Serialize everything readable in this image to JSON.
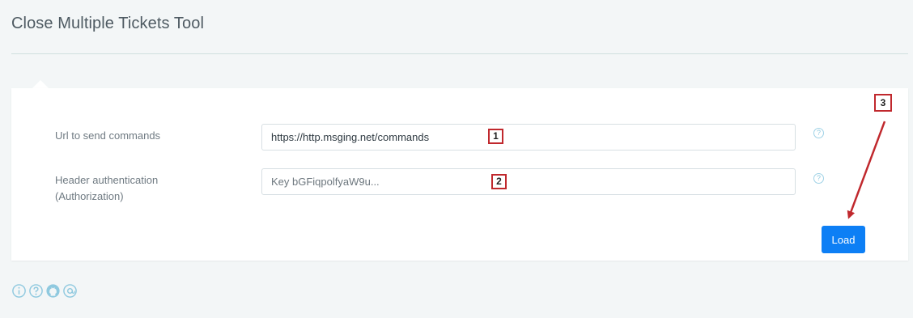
{
  "page": {
    "title": "Close Multiple Tickets Tool"
  },
  "form": {
    "url_label": "Url to send commands",
    "url_value": "https://http.msging.net/commands",
    "auth_label_line1": "Header authentication",
    "auth_label_line2": "(Authorization)",
    "auth_placeholder": "Key bGFiqpolfyaW9u...",
    "help_icon_glyph": "?",
    "load_label": "Load"
  },
  "annotations": {
    "step1": "1",
    "step2": "2",
    "step3": "3"
  },
  "colors": {
    "accent": "#0d7ff5",
    "annotation_red": "#c0282d",
    "help_icon": "#8fc9df",
    "footer_icon": "#8fc9df"
  },
  "footer": {
    "icons": [
      "info-icon",
      "help-icon",
      "github-icon",
      "at-sign-icon"
    ]
  }
}
